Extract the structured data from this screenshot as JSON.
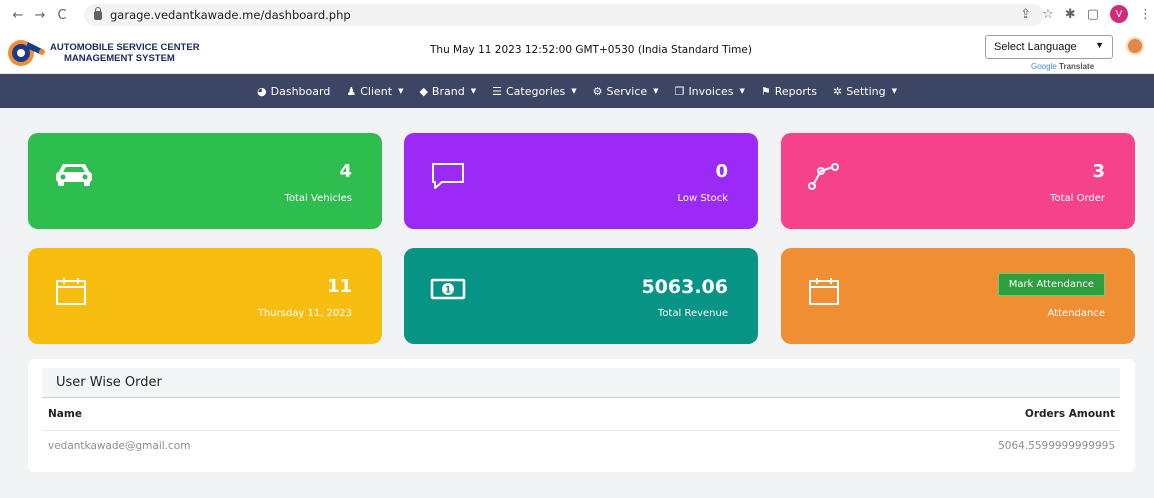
{
  "browser": {
    "back": "←",
    "forward": "→",
    "reload": "C",
    "url": "garage.vedantkawade.me/dashboard.php",
    "profile_initial": "V"
  },
  "header": {
    "brand_line1": "AUTOMOBILE SERVICE CENTER",
    "brand_line2": "MANAGEMENT SYSTEM",
    "datetime": "Thu May 11 2023 12:52:00 GMT+0530 (India Standard Time)",
    "language_select": "Select Language",
    "translate_google": "Google",
    "translate_text": "Translate"
  },
  "navbar": {
    "items": [
      {
        "label": "Dashboard",
        "icon": "dashboard-icon",
        "dropdown": false
      },
      {
        "label": "Client",
        "icon": "user-icon",
        "dropdown": true
      },
      {
        "label": "Brand",
        "icon": "tag-icon",
        "dropdown": true
      },
      {
        "label": "Categories",
        "icon": "list-icon",
        "dropdown": true
      },
      {
        "label": "Service",
        "icon": "gears-icon",
        "dropdown": true
      },
      {
        "label": "Invoices",
        "icon": "invoice-icon",
        "dropdown": true
      },
      {
        "label": "Reports",
        "icon": "flag-icon",
        "dropdown": false
      },
      {
        "label": "Setting",
        "icon": "gear-icon",
        "dropdown": true
      }
    ]
  },
  "cards": {
    "vehicles": {
      "value": "4",
      "label": "Total Vehicles",
      "icon": "car-icon",
      "color": "#2dbe4f"
    },
    "stock": {
      "value": "0",
      "label": "Low Stock",
      "icon": "comment-icon",
      "color": "#9b2af7"
    },
    "orders": {
      "value": "3",
      "label": "Total Order",
      "icon": "share-icon",
      "color": "#f6428a"
    },
    "date": {
      "value": "11",
      "label": "Thursday 11, 2023",
      "icon": "calendar-icon",
      "color": "#f7bd10"
    },
    "revenue": {
      "value": "5063.06",
      "label": "Total Revenue",
      "icon": "money-icon",
      "color": "#079484"
    },
    "attendance": {
      "button": "Mark Attendance",
      "label": "Attendance",
      "icon": "calendar-icon",
      "color": "#f08e33"
    }
  },
  "user_orders": {
    "title": "User Wise Order",
    "col_name": "Name",
    "col_amount": "Orders Amount",
    "rows": [
      {
        "name": "vedantkawade@gmail.com",
        "amount": "5064.5599999999995"
      }
    ]
  }
}
